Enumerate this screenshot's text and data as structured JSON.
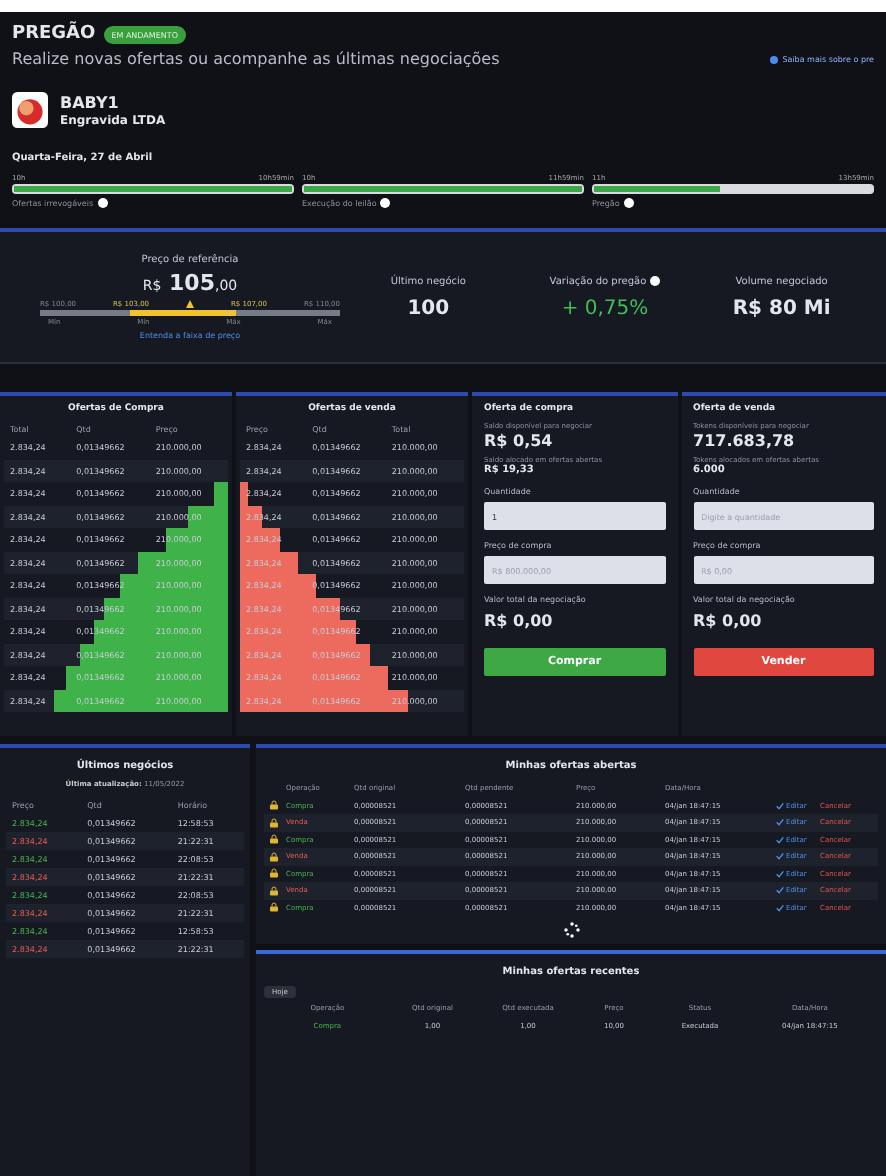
{
  "header": {
    "title": "PREGÃO",
    "badge": "EM ANDAMENTO",
    "subtitle": "Realize novas ofertas ou acompanhe as últimas negociações",
    "help_link": "Saiba mais sobre o pre"
  },
  "company": {
    "ticker": "BABY1",
    "name": "Engravida LTDA"
  },
  "date": "Quarta-Feira, 27 de Abril",
  "phases": [
    {
      "start": "10h",
      "end": "10h59min",
      "caption": "Ofertas irrevogáveis",
      "level": 1
    },
    {
      "start": "10h",
      "end": "11h59min",
      "caption": "Execução do leilão",
      "level": 1
    },
    {
      "start": "11h",
      "end": "13h59min",
      "caption": "Pregão",
      "level": 0.45
    }
  ],
  "price": {
    "label": "Preço de referência",
    "currency": "R$",
    "value": "105",
    "cents": ",00",
    "outer_min": "R$ 100,00",
    "inner_min": "R$ 103,00",
    "inner_max": "R$ 107,00",
    "outer_max": "R$ 110,00",
    "min_labels": [
      "Mín",
      "Mín"
    ],
    "max_labels": [
      "Máx",
      "Máx"
    ],
    "level": 0.5,
    "link": "Entenda a faixa de preço"
  },
  "stats": [
    {
      "label": "Último negócio",
      "value": "100",
      "kind": "plain"
    },
    {
      "label": "Variação do pregão",
      "value": "+ 0,75%",
      "kind": "positive"
    },
    {
      "label": "Volume negociado",
      "value": "R$ 80 Mi",
      "kind": "plain"
    }
  ],
  "buy_book": {
    "title": "Ofertas de Compra",
    "columns": [
      "Total",
      "Qtd",
      "Preço"
    ],
    "rows": [
      {
        "total": "2.834,24",
        "qty": "0,01349662",
        "price": "210.000,00"
      },
      {
        "total": "2.834,24",
        "qty": "0,01349662",
        "price": "210.000,00"
      },
      {
        "total": "2.834,24",
        "qty": "0,01349662",
        "price": "210.000,00",
        "level": 0.06
      },
      {
        "total": "2.834,24",
        "qty": "0,01349662",
        "price": "210.000,00",
        "level": 0.18
      },
      {
        "total": "2.834,24",
        "qty": "0,01349662",
        "price": "210.000,00",
        "level": 0.28
      },
      {
        "total": "2.834,24",
        "qty": "0,01349662",
        "price": "210.000,00",
        "level": 0.4
      },
      {
        "total": "2.834,24",
        "qty": "0,01349662",
        "price": "210.000,00",
        "level": 0.48
      },
      {
        "total": "2.834,24",
        "qty": "0,01349662",
        "price": "210.000,00",
        "level": 0.55
      },
      {
        "total": "2.834,24",
        "qty": "0,01349662",
        "price": "210.000,00",
        "level": 0.6
      },
      {
        "total": "2.834,24",
        "qty": "0,01349662",
        "price": "210.000,00",
        "level": 0.66
      },
      {
        "total": "2.834,24",
        "qty": "0,01349662",
        "price": "210.000,00",
        "level": 0.72
      },
      {
        "total": "2.834,24",
        "qty": "0,01349662",
        "price": "210.000,00",
        "level": 0.78
      }
    ]
  },
  "sell_book": {
    "title": "Ofertas de venda",
    "columns": [
      "Preço",
      "Qtd",
      "Total"
    ],
    "rows": [
      {
        "price": "2.834,24",
        "qty": "0,01349662",
        "total": "210.000,00"
      },
      {
        "price": "2.834,24",
        "qty": "0,01349662",
        "total": "210.000,00"
      },
      {
        "price": "2.834,24",
        "qty": "0,01349662",
        "total": "210.000,00",
        "level": 0.04
      },
      {
        "price": "2.834,24",
        "qty": "0,01349662",
        "total": "210.000,00",
        "level": 0.1
      },
      {
        "price": "2.834,24",
        "qty": "0,01349662",
        "total": "210.000,00",
        "level": 0.18
      },
      {
        "price": "2.834,24",
        "qty": "0,01349662",
        "total": "210.000,00",
        "level": 0.26
      },
      {
        "price": "2.834,24",
        "qty": "0,01349662",
        "total": "210.000,00",
        "level": 0.34
      },
      {
        "price": "2.834,24",
        "qty": "0,01349662",
        "total": "210.000,00",
        "level": 0.45
      },
      {
        "price": "2.834,24",
        "qty": "0,01349662",
        "total": "210.000,00",
        "level": 0.52
      },
      {
        "price": "2.834,24",
        "qty": "0,01349662",
        "total": "210.000,00",
        "level": 0.58
      },
      {
        "price": "2.834,24",
        "qty": "0,01349662",
        "total": "210.000,00",
        "level": 0.66
      },
      {
        "price": "2.834,24",
        "qty": "0,01349662",
        "total": "210.000,00",
        "level": 0.75
      }
    ]
  },
  "order_forms": [
    {
      "kind": "buy",
      "title": "Oferta de compra",
      "balance_label": "Saldo disponível para negociar",
      "balance": "R$ 0,54",
      "allocated_label": "Saldo alocado em ofertas abertas",
      "allocated": "R$ 19,33",
      "qty_label": "Quantidade",
      "qty_value": "1",
      "price_label": "Preço de compra",
      "price_placeholder": "R$ 800.000,00",
      "total_label": "Valor total da negociação",
      "total": "R$ 0,00",
      "button": "Comprar"
    },
    {
      "kind": "sell",
      "title": "Oferta de venda",
      "balance_label": "Tokens disponíveis para negociar",
      "balance": "717.683,78",
      "allocated_label": "Tokens alocados em ofertas abertas",
      "allocated": "6.000",
      "qty_label": "Quantidade",
      "qty_placeholder": "Digite a quantidade",
      "price_label": "Preço de compra",
      "price_placeholder": "R$ 0,00",
      "total_label": "Valor total da negociação",
      "total": "R$ 0,00",
      "button": "Vender"
    }
  ],
  "trades": {
    "title": "Últimos negócios",
    "updated_label": "Última atualização:",
    "updated": "11/05/2022",
    "columns": [
      "Preço",
      "Qtd",
      "Horário"
    ],
    "rows": [
      {
        "price": "2.834,24",
        "qty": "0,01349662",
        "time": "12:58:53",
        "kind": "buy"
      },
      {
        "price": "2.834,24",
        "qty": "0,01349662",
        "time": "21:22:31",
        "kind": "sell"
      },
      {
        "price": "2.834,24",
        "qty": "0,01349662",
        "time": "22:08:53",
        "kind": "buy"
      },
      {
        "price": "2.834,24",
        "qty": "0,01349662",
        "time": "21:22:31",
        "kind": "sell"
      },
      {
        "price": "2.834,24",
        "qty": "0,01349662",
        "time": "22:08:53",
        "kind": "buy"
      },
      {
        "price": "2.834,24",
        "qty": "0,01349662",
        "time": "21:22:31",
        "kind": "sell"
      },
      {
        "price": "2.834,24",
        "qty": "0,01349662",
        "time": "12:58:53",
        "kind": "buy"
      },
      {
        "price": "2.834,24",
        "qty": "0,01349662",
        "time": "21:22:31",
        "kind": "sell"
      }
    ]
  },
  "open_offers": {
    "title": "Minhas ofertas abertas",
    "columns": [
      "Operação",
      "Qtd original",
      "Qtd pendente",
      "Preço",
      "Data/Hora"
    ],
    "rows": [
      {
        "operation": "Compra",
        "kind": "buy",
        "qty_original": "0,00008521",
        "qty_pending": "0,00008521",
        "price": "210.000,00",
        "datetime": "04/jan 18:47:15",
        "edit": "Editar",
        "cancel": "Cancelar"
      },
      {
        "operation": "Venda",
        "kind": "sell",
        "qty_original": "0,00008521",
        "qty_pending": "0,00008521",
        "price": "210.000,00",
        "datetime": "04/jan 18:47:15",
        "edit": "Editar",
        "cancel": "Cancelar"
      },
      {
        "operation": "Compra",
        "kind": "buy",
        "qty_original": "0,00008521",
        "qty_pending": "0,00008521",
        "price": "210.000,00",
        "datetime": "04/jan 18:47:15",
        "edit": "Editar",
        "cancel": "Cancelar"
      },
      {
        "operation": "Venda",
        "kind": "sell",
        "qty_original": "0,00008521",
        "qty_pending": "0,00008521",
        "price": "210.000,00",
        "datetime": "04/jan 18:47:15",
        "edit": "Editar",
        "cancel": "Cancelar"
      },
      {
        "operation": "Compra",
        "kind": "buy",
        "qty_original": "0,00008521",
        "qty_pending": "0,00008521",
        "price": "210.000,00",
        "datetime": "04/jan 18:47:15",
        "edit": "Editar",
        "cancel": "Cancelar"
      },
      {
        "operation": "Venda",
        "kind": "sell",
        "qty_original": "0,00008521",
        "qty_pending": "0,00008521",
        "price": "210.000,00",
        "datetime": "04/jan 18:47:15",
        "edit": "Editar",
        "cancel": "Cancelar"
      },
      {
        "operation": "Compra",
        "kind": "buy",
        "qty_original": "0,00008521",
        "qty_pending": "0,00008521",
        "price": "210.000,00",
        "datetime": "04/jan 18:47:15",
        "edit": "Editar",
        "cancel": "Cancelar"
      }
    ]
  },
  "recent_offers": {
    "title": "Minhas ofertas recentes",
    "filter": "Hoje",
    "columns": [
      "Operação",
      "Qtd original",
      "Qtd executada",
      "Preço",
      "Status",
      "Data/Hora"
    ],
    "rows": [
      {
        "operation": "Compra",
        "kind": "buy",
        "qty_original": "1,00",
        "qty_executed": "1,00",
        "price": "10,00",
        "status": "Executada",
        "datetime": "04/jan 18:47:15"
      }
    ]
  }
}
